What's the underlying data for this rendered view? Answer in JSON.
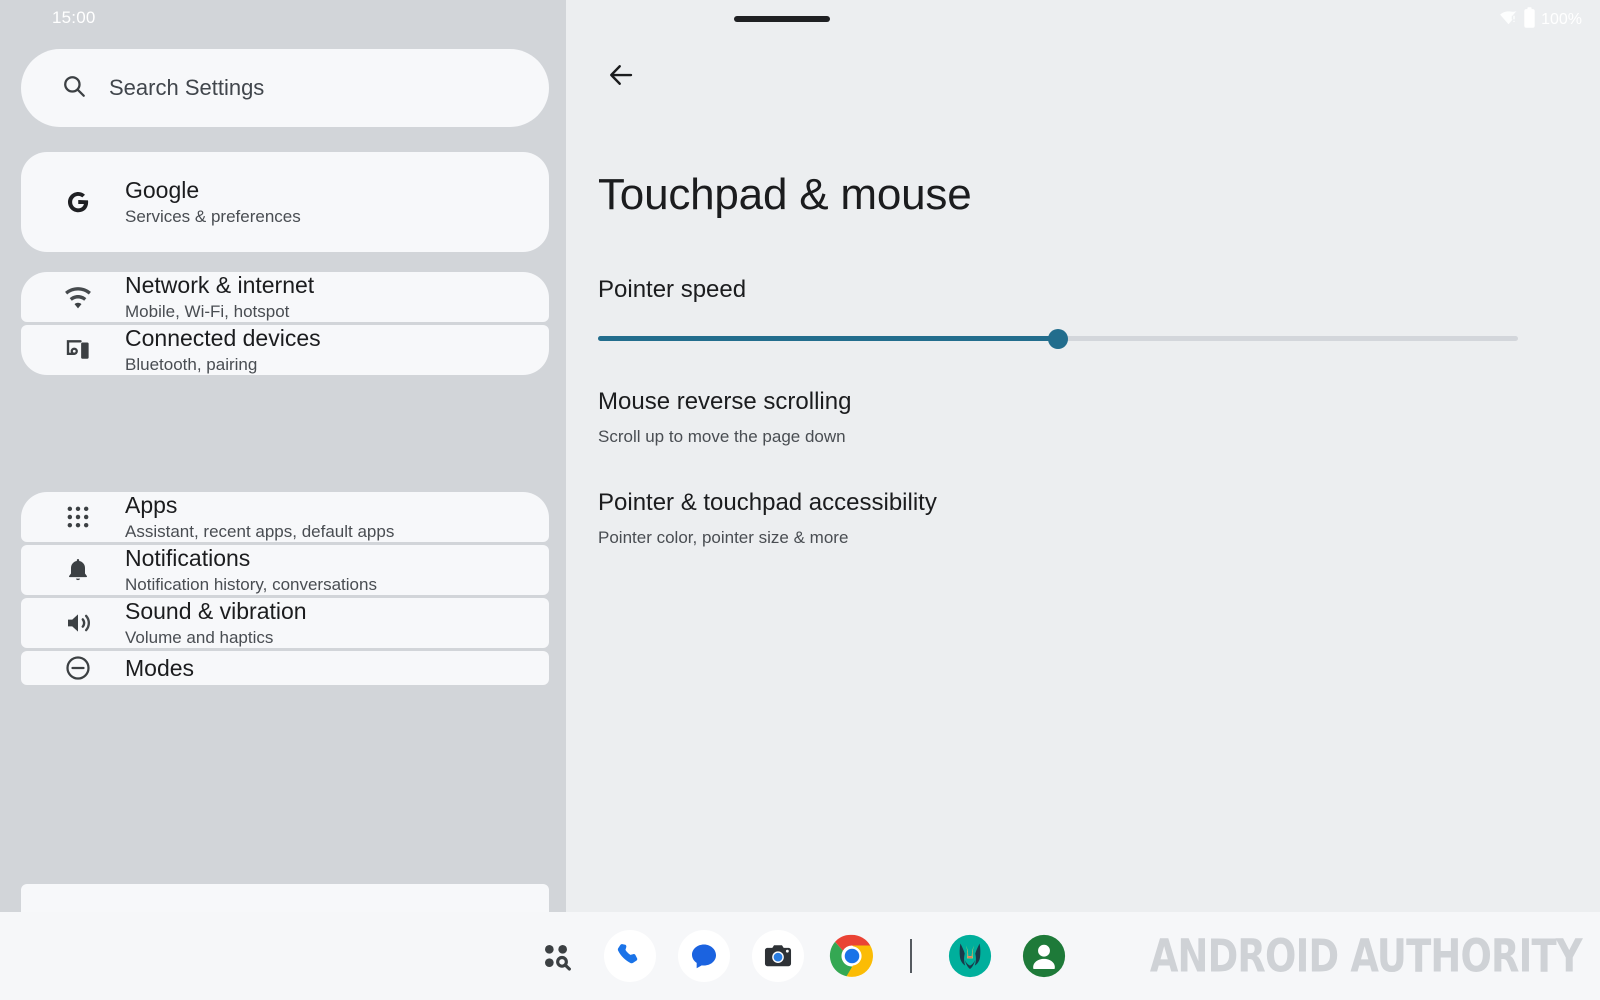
{
  "status_bar": {
    "time": "15:00",
    "battery_percent": "100%",
    "wifi_icon": "wifi-warning-icon",
    "battery_icon": "battery-full-icon"
  },
  "sidebar": {
    "search": {
      "placeholder": "Search Settings",
      "icon": "search-icon"
    },
    "groups": [
      {
        "items": [
          {
            "icon": "google-g-icon",
            "title": "Google",
            "subtitle": "Services & preferences"
          }
        ]
      },
      {
        "items": [
          {
            "icon": "wifi-icon",
            "title": "Network & internet",
            "subtitle": "Mobile, Wi-Fi, hotspot"
          },
          {
            "icon": "connected-devices-icon",
            "title": "Connected devices",
            "subtitle": "Bluetooth, pairing"
          }
        ]
      },
      {
        "items": [
          {
            "icon": "apps-grid-icon",
            "title": "Apps",
            "subtitle": "Assistant, recent apps, default apps"
          },
          {
            "icon": "bell-icon",
            "title": "Notifications",
            "subtitle": "Notification history, conversations"
          },
          {
            "icon": "sound-icon",
            "title": "Sound & vibration",
            "subtitle": "Volume and haptics"
          },
          {
            "icon": "modes-icon",
            "title": "Modes",
            "subtitle": ""
          }
        ]
      }
    ]
  },
  "main": {
    "back_icon": "back-arrow-icon",
    "title": "Touchpad & mouse",
    "pointer_speed": {
      "label": "Pointer speed",
      "value_percent": 50,
      "accent_color": "#226d8d",
      "track_color": "#d3d6db"
    },
    "settings": [
      {
        "title": "Mouse reverse scrolling",
        "subtitle": "Scroll up to move the page down",
        "control": "toggle",
        "enabled": true
      },
      {
        "title": "Pointer & touchpad accessibility",
        "subtitle": "Pointer color, pointer size & more",
        "control": "navigate"
      }
    ]
  },
  "taskbar": {
    "items": [
      {
        "name": "app-drawer-search-icon",
        "label": "All apps"
      },
      {
        "name": "phone-icon",
        "label": "Phone"
      },
      {
        "name": "messages-icon",
        "label": "Messages"
      },
      {
        "name": "camera-icon",
        "label": "Camera"
      },
      {
        "name": "chrome-icon",
        "label": "Chrome"
      },
      {
        "name": "divider",
        "label": ""
      },
      {
        "name": "magisk-icon",
        "label": "Magisk"
      },
      {
        "name": "contacts-icon",
        "label": "Contacts"
      }
    ],
    "watermark": "ANDROID AUTHORITY"
  },
  "cursor": {
    "icon": "mouse-pointer-icon"
  }
}
